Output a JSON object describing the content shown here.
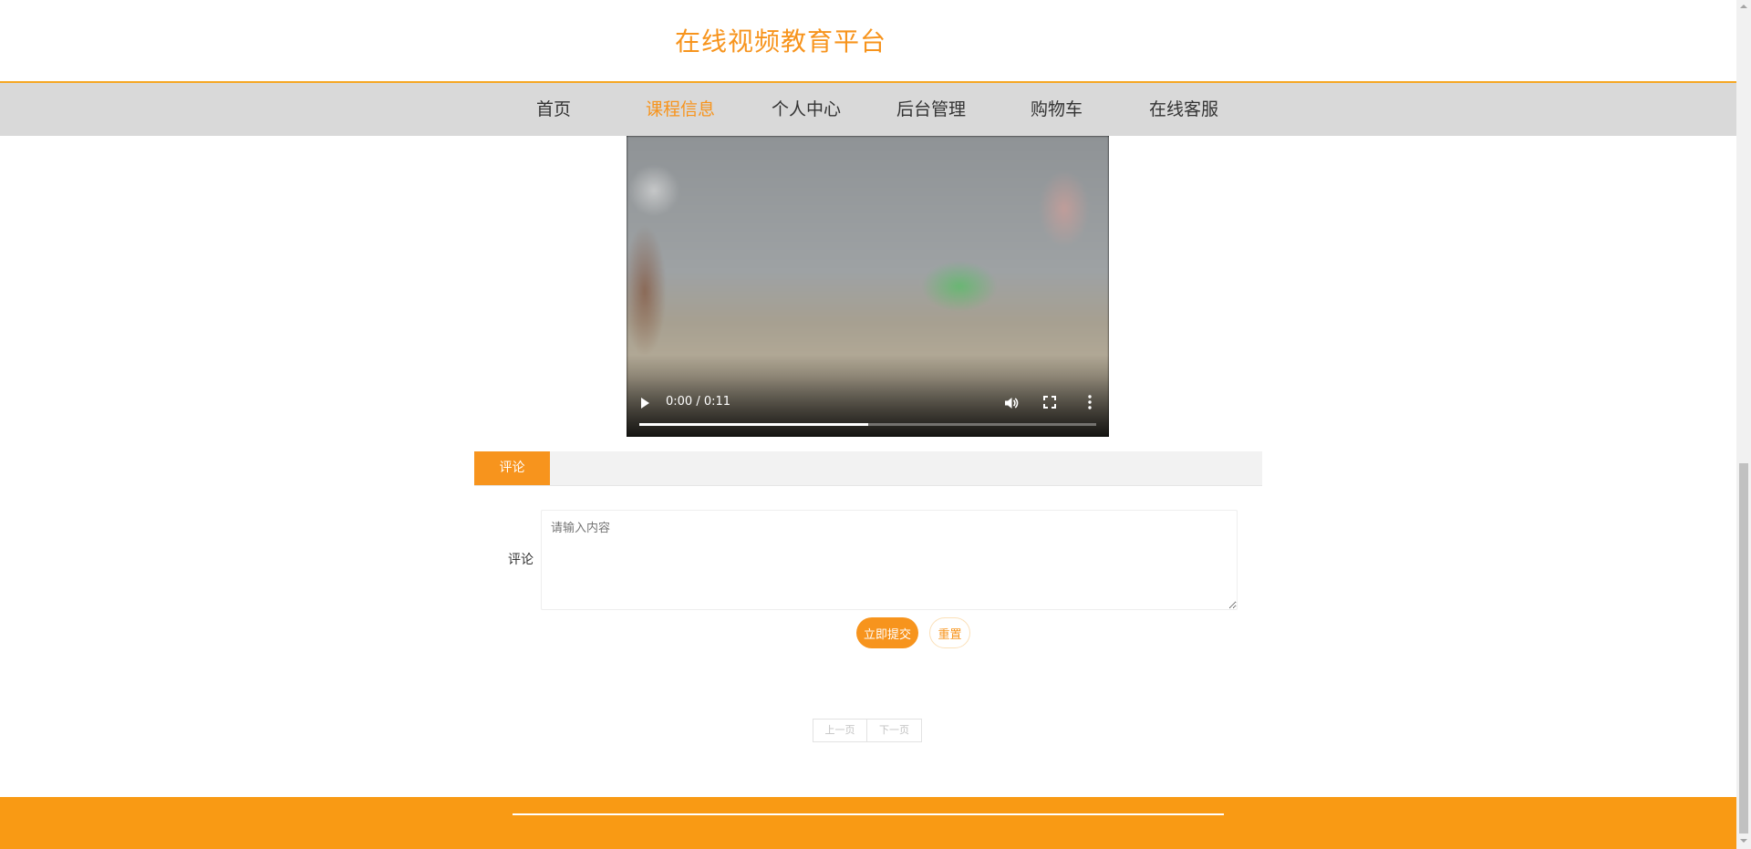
{
  "header": {
    "title": "在线视频教育平台"
  },
  "nav": {
    "items": [
      {
        "label": "首页",
        "active": false
      },
      {
        "label": "课程信息",
        "active": true
      },
      {
        "label": "个人中心",
        "active": false
      },
      {
        "label": "后台管理",
        "active": false
      },
      {
        "label": "购物车",
        "active": false
      },
      {
        "label": "在线客服",
        "active": false
      }
    ]
  },
  "video": {
    "time_display": "0:00 / 0:11",
    "buffered_fraction": 0.5,
    "icons": [
      "play-icon",
      "volume-icon",
      "fullscreen-icon",
      "more-options-icon"
    ]
  },
  "tabs": {
    "active_label": "评论"
  },
  "comment_form": {
    "label": "评论",
    "placeholder": "请输入内容",
    "value": "",
    "submit_label": "立即提交",
    "reset_label": "重置"
  },
  "pagination": {
    "prev_label": "上一页",
    "next_label": "下一页"
  },
  "colors": {
    "accent": "#f7941d",
    "footer": "#f99a14",
    "nav_background": "#d9d9d9"
  }
}
